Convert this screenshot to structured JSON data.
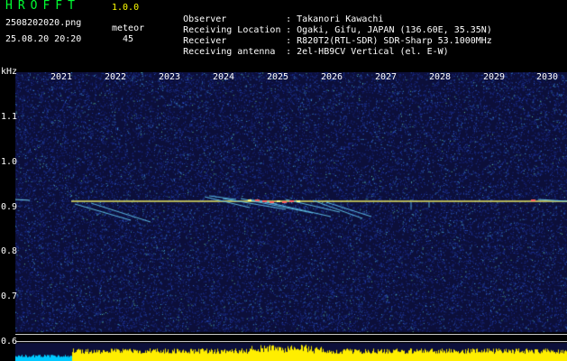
{
  "header": {
    "app_name": "HROFFT",
    "version": "1.0.0",
    "file_name": "2508202020.png",
    "timestamp": "25.08.20 20:20",
    "mode_label": "meteor",
    "mode_count": "45"
  },
  "station_info": [
    {
      "key": "Observer",
      "sep": ":",
      "value": "Takanori Kawachi"
    },
    {
      "key": "Receiving Location",
      "sep": ":",
      "value": "Ogaki, Gifu, JAPAN (136.60E, 35.35N)"
    },
    {
      "key": "Receiver",
      "sep": ":",
      "value": "R820T2(RTL-SDR) SDR-Sharp 53.1000MHz"
    },
    {
      "key": "Receiving antenna",
      "sep": ":",
      "value": "2el-HB9CV Vertical (el. E-W)"
    }
  ],
  "time_axis": {
    "labels": [
      "2021",
      "2022",
      "2023",
      "2024",
      "2025",
      "2026",
      "2027",
      "2028",
      "2029",
      "2030"
    ]
  },
  "freq_axis": {
    "unit_label": "kHz",
    "ticks": [
      "1.1",
      "1.0",
      "0.9",
      "0.8",
      "0.7",
      "0.6"
    ]
  },
  "colors": {
    "background_noise": "#10144a",
    "carrier": "#e8e860",
    "meteor_trace": "#5ab8e0",
    "activity_bar": "#ffee00",
    "activity_bar_alt": "#00c8ff"
  }
}
